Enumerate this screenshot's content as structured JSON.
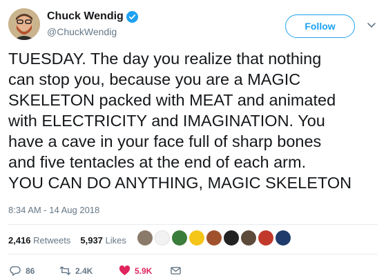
{
  "author": {
    "name": "Chuck Wendig",
    "handle": "@ChuckWendig",
    "verified_icon": "verified-badge-icon"
  },
  "follow_label": "Follow",
  "tweet": {
    "text": "TUESDAY. The day you realize that nothing\ncan stop you, because you are a MAGIC\nSKELETON packed with MEAT and animated\nwith ELECTRICITY and IMAGINATION. You\nhave a cave in your face full of sharp bones\nand five tentacles at the end of each arm.\nYOU CAN DO ANYTHING, MAGIC SKELETON",
    "timestamp": "8:34 AM - 14 Aug 2018"
  },
  "stats": {
    "retweets_count": "2,416",
    "retweets_label": "Retweets",
    "likes_count": "5,937",
    "likes_label": "Likes"
  },
  "actions": {
    "reply_count": "86",
    "retweet_count": "2.4K",
    "like_count": "5.9K"
  },
  "colors": {
    "brand": "#1da1f2",
    "like": "#e0245e",
    "retweet": "#17bf63",
    "muted": "#657786"
  }
}
